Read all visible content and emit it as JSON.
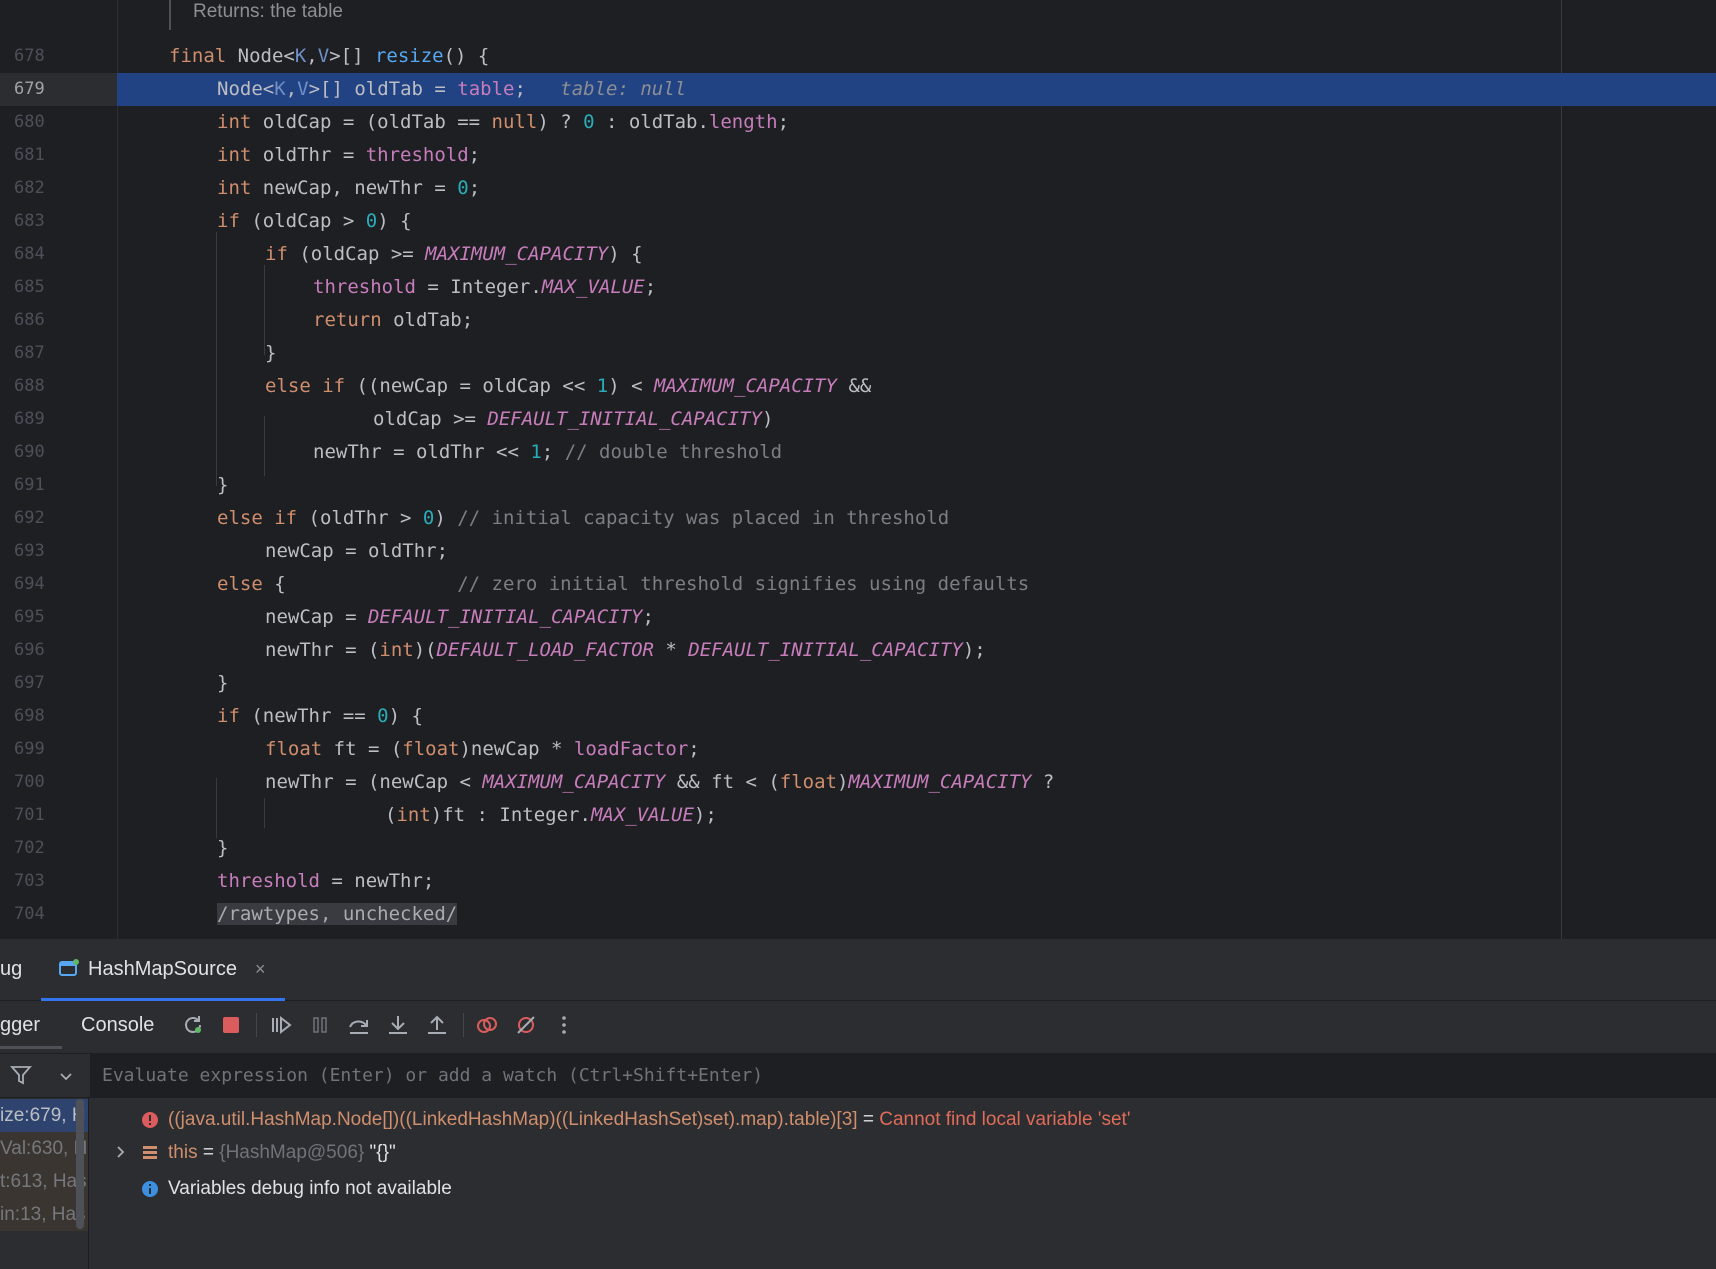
{
  "editor": {
    "doc_comment": "Returns: the table",
    "current_line": "679",
    "lines": [
      {
        "num": "678"
      },
      {
        "num": "679"
      },
      {
        "num": "680"
      },
      {
        "num": "681"
      },
      {
        "num": "682"
      },
      {
        "num": "683"
      },
      {
        "num": "684"
      },
      {
        "num": "685"
      },
      {
        "num": "686"
      },
      {
        "num": "687"
      },
      {
        "num": "688"
      },
      {
        "num": "689"
      },
      {
        "num": "690"
      },
      {
        "num": "691"
      },
      {
        "num": "692"
      },
      {
        "num": "693"
      },
      {
        "num": "694"
      },
      {
        "num": "695"
      },
      {
        "num": "696"
      },
      {
        "num": "697"
      },
      {
        "num": "698"
      },
      {
        "num": "699"
      },
      {
        "num": "700"
      },
      {
        "num": "701"
      },
      {
        "num": "702"
      },
      {
        "num": "703"
      },
      {
        "num": "704"
      }
    ],
    "code": {
      "l678": {
        "final": "final",
        "node": " Node<",
        "k": "K",
        "comma": ",",
        "v": "V",
        "rest": ">[] ",
        "resize": "resize",
        "tail": "() {"
      },
      "l679": {
        "node": "Node<",
        "k": "K",
        "comma": ",",
        "v": "V",
        "mid": ">[] oldTab = ",
        "table": "table",
        "semi": ";",
        "inline": "table: null"
      },
      "l680": {
        "int": "int",
        "a": " oldCap = (oldTab == ",
        "null": "null",
        "b": ") ? ",
        "zero": "0",
        "c": " : oldTab.",
        "length": "length",
        "d": ";"
      },
      "l681": {
        "int": "int",
        "a": " oldThr = ",
        "threshold": "threshold",
        "b": ";"
      },
      "l682": {
        "int": "int",
        "a": " newCap, newThr = ",
        "zero": "0",
        "b": ";"
      },
      "l683": {
        "if": "if",
        "a": " (oldCap > ",
        "zero": "0",
        "b": ") {"
      },
      "l684": {
        "if": "if",
        "a": " (oldCap >= ",
        "max": "MAXIMUM_CAPACITY",
        "b": ") {"
      },
      "l685": {
        "threshold": "threshold",
        "a": " = Integer.",
        "maxv": "MAX_VALUE",
        "b": ";"
      },
      "l686": {
        "return": "return",
        "a": " oldTab;"
      },
      "l687": {
        "a": "}"
      },
      "l688": {
        "elseif": "else if",
        "a": " ((newCap = oldCap << ",
        "one": "1",
        "b": ") < ",
        "max": "MAXIMUM_CAPACITY",
        "c": " &&"
      },
      "l689": {
        "a": "oldCap >= ",
        "dic": "DEFAULT_INITIAL_CAPACITY",
        "b": ")"
      },
      "l690": {
        "a": "newThr = oldThr << ",
        "one": "1",
        "b": "; ",
        "comment": "// double threshold"
      },
      "l691": {
        "a": "}"
      },
      "l692": {
        "elseif": "else if",
        "a": " (oldThr > ",
        "zero": "0",
        "b": ") ",
        "comment": "// initial capacity was placed in threshold"
      },
      "l693": {
        "a": "newCap = oldThr;"
      },
      "l694": {
        "else": "else",
        "a": " {               ",
        "comment": "// zero initial threshold signifies using defaults"
      },
      "l695": {
        "a": "newCap = ",
        "dic": "DEFAULT_INITIAL_CAPACITY",
        "b": ";"
      },
      "l696": {
        "a": "newThr = (",
        "int": "int",
        "b": ")(",
        "dlf": "DEFAULT_LOAD_FACTOR",
        "c": " * ",
        "dic": "DEFAULT_INITIAL_CAPACITY",
        "d": ");"
      },
      "l697": {
        "a": "}"
      },
      "l698": {
        "if": "if",
        "a": " (newThr == ",
        "zero": "0",
        "b": ") {"
      },
      "l699": {
        "float": "float",
        "a": " ft = (",
        "float2": "float",
        "b": ")newCap * ",
        "lf": "loadFactor",
        "c": ";"
      },
      "l700": {
        "a": "newThr = (newCap < ",
        "max": "MAXIMUM_CAPACITY",
        "b": " && ft < (",
        "float": "float",
        "c": ")",
        "max2": "MAXIMUM_CAPACITY",
        "d": " ?"
      },
      "l701": {
        "a": "(",
        "int": "int",
        "b": ")ft : Integer.",
        "maxv": "MAX_VALUE",
        "c": ");"
      },
      "l702": {
        "a": "}"
      },
      "l703": {
        "threshold": "threshold",
        "a": " = newThr;"
      },
      "l704": {
        "suppress": "/rawtypes, unchecked/"
      }
    }
  },
  "debug_panel": {
    "tab_partial": "ug",
    "tab_label": "HashMapSource",
    "tab_close": "×",
    "toolbar": {
      "debugger_partial": "gger",
      "console": "Console"
    },
    "evaluate_placeholder": "Evaluate expression (Enter) or add a watch (Ctrl+Shift+Enter)",
    "frames": [
      "ize:679, H",
      "Val:630, H",
      "t:613, Has",
      "in:13, Has"
    ],
    "variables": [
      {
        "type": "error",
        "expr": "((java.util.HashMap.Node[])((LinkedHashMap)((LinkedHashSet)set).map).table)[3]",
        "eq": " = ",
        "value": "Cannot find local variable 'set'"
      },
      {
        "type": "object",
        "name": "this",
        "eq": " = ",
        "ref": "{HashMap@506}",
        "value": " \"{}\""
      },
      {
        "type": "info",
        "text": "Variables debug info not available"
      }
    ]
  },
  "colors": {
    "editor_bg": "#1e1f22",
    "current_line": "#214283",
    "keyword": "#cf8e6d",
    "field": "#c77dbb",
    "number": "#2aacb8",
    "error": "#e06c5a",
    "accent": "#3574f0"
  }
}
